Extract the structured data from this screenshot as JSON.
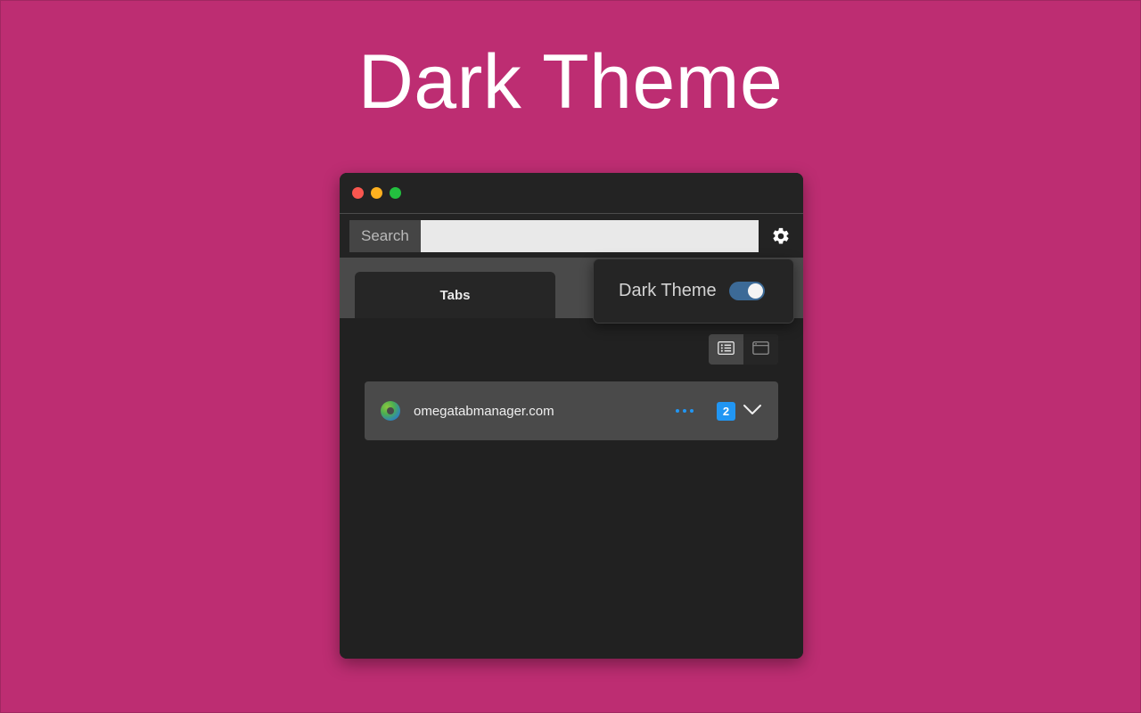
{
  "page": {
    "title": "Dark Theme",
    "background_color": "#bd2d72"
  },
  "window": {
    "traffic_lights": [
      {
        "name": "close",
        "color": "#f9564f"
      },
      {
        "name": "minimize",
        "color": "#fdb01f"
      },
      {
        "name": "maximize",
        "color": "#23c03f"
      }
    ],
    "search": {
      "label": "Search",
      "value": "",
      "placeholder": ""
    },
    "settings_icon": "gear-icon",
    "tabs_bar": {
      "tabs": [
        {
          "label": "Tabs",
          "active": true
        }
      ]
    },
    "settings_dropdown": {
      "visible": true,
      "items": [
        {
          "label": "Dark Theme",
          "control": "toggle",
          "enabled": true,
          "accent_color": "#3c6a97"
        }
      ]
    },
    "view_toggle": {
      "options": [
        {
          "name": "list-view",
          "icon": "list-view-icon",
          "active": true
        },
        {
          "name": "card-view",
          "icon": "window-view-icon",
          "active": false
        }
      ]
    },
    "tab_list": [
      {
        "favicon": "omega-favicon",
        "title": "omegatabmanager.com",
        "menu_icon": "more-options-icon",
        "count": "2",
        "count_color": "#2196f3",
        "expand_icon": "chevron-down-icon"
      }
    ]
  }
}
